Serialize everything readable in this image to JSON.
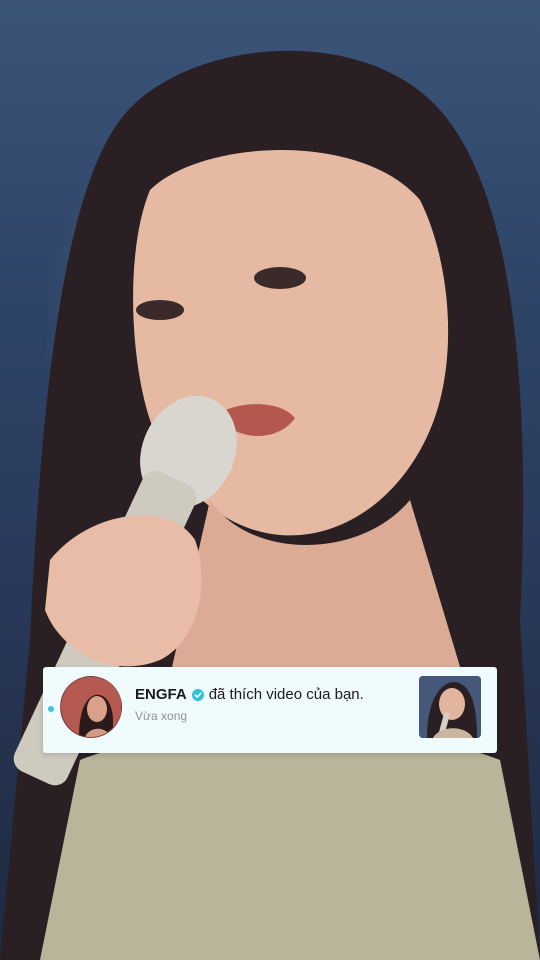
{
  "video": {
    "background_icon": "video-frame"
  },
  "notification": {
    "username": "ENGFA",
    "action_text": "đã thích video của bạn.",
    "timestamp": "Vừa xong",
    "verified": true,
    "colors": {
      "card_bg": "#f0fbfd",
      "accent": "#2cc5d8",
      "text": "#1b1b1b",
      "muted": "#8e9599"
    }
  }
}
